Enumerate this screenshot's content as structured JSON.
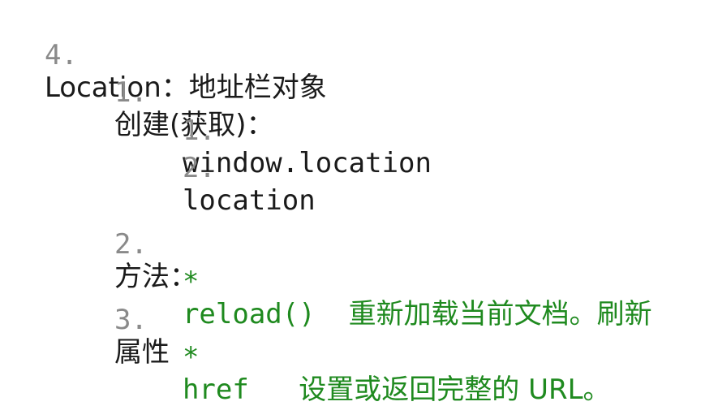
{
  "outline": {
    "item4": {
      "number": "4.",
      "title": "Location",
      "separator": "：",
      "desc": "地址栏对象"
    },
    "create": {
      "number": "1.",
      "label": "创建(获取)：",
      "items": [
        {
          "number": "1.",
          "code": "window.location"
        },
        {
          "number": "2.",
          "code": "location"
        }
      ]
    },
    "methods": {
      "number": "2.",
      "label": "方法：",
      "bullet": "*",
      "code": "reload()",
      "desc": "重新加载当前文档。刷新"
    },
    "properties": {
      "number": "3.",
      "label": "属性",
      "bullet": "*",
      "code": "href",
      "desc": "设置或返回完整的 URL。"
    }
  }
}
